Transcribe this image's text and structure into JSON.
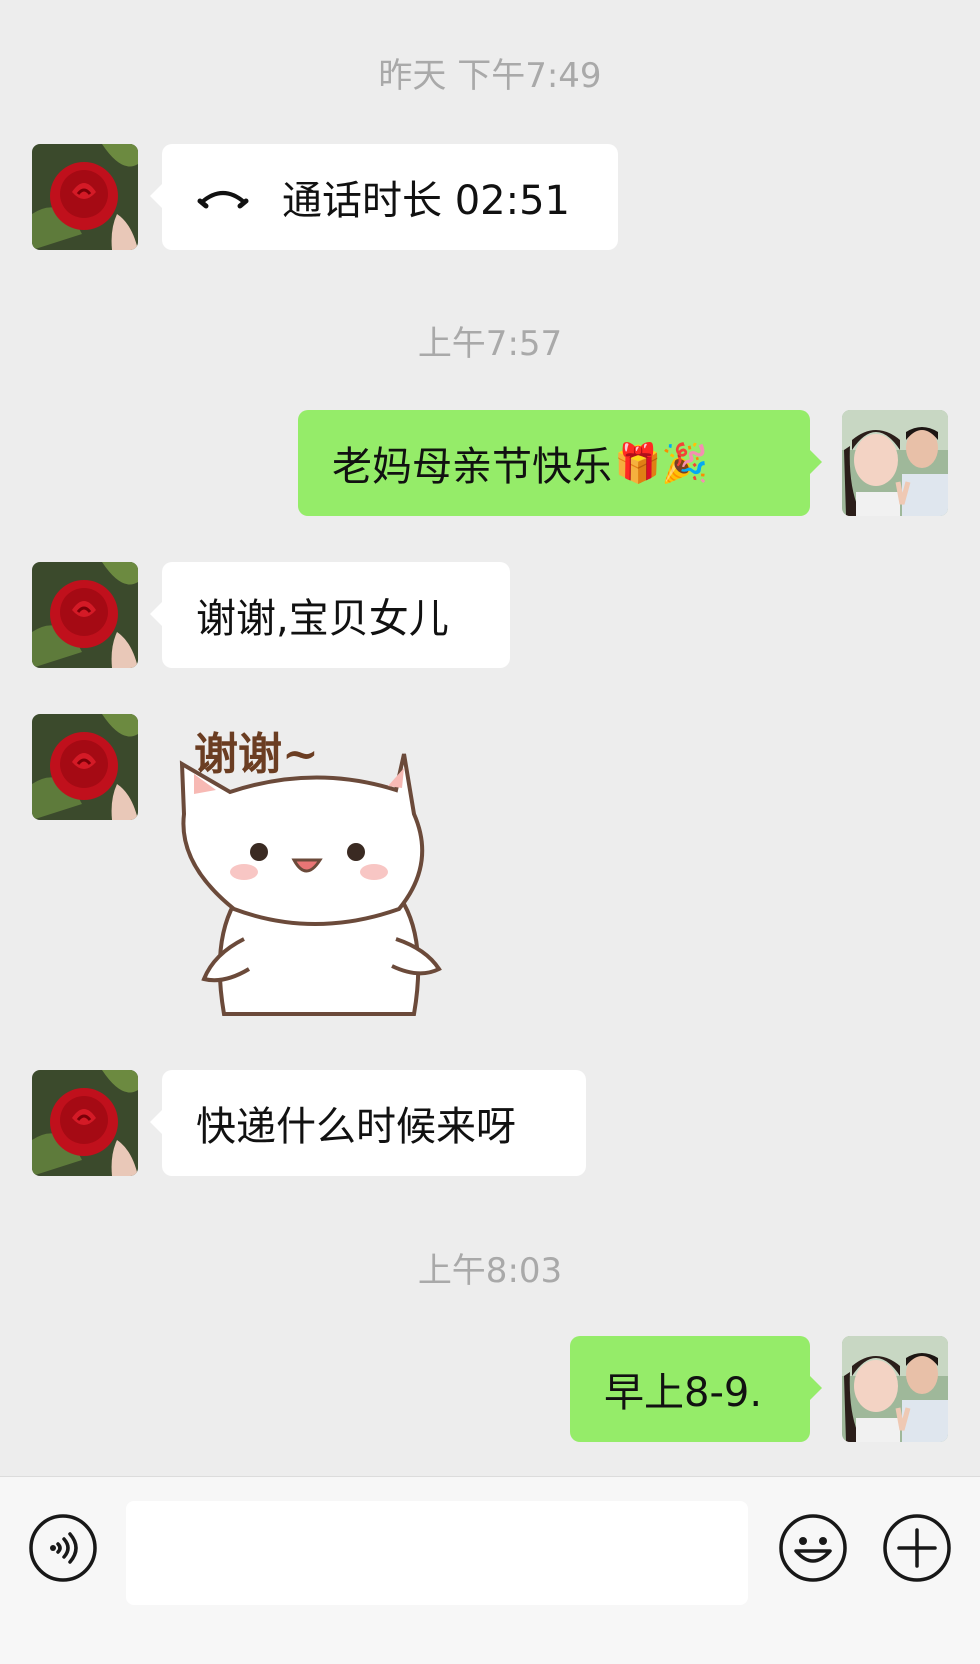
{
  "chat": {
    "timestamps": [
      "昨天 下午7:49",
      "上午7:57",
      "上午8:03"
    ],
    "call": {
      "icon": "phone-hangup-icon",
      "label": "通话时长 02:51"
    },
    "messages": {
      "sent_1": {
        "text": "老妈母亲节快乐",
        "emojis": "🎁🎉"
      },
      "recv_1": "谢谢,宝贝女儿",
      "sticker_text": "谢谢~",
      "recv_2": "快递什么时候来呀",
      "sent_2": "早上8-9."
    }
  },
  "input_bar": {
    "voice_icon": "voice-icon",
    "emoji_icon": "smiley-icon",
    "more_icon": "plus-icon",
    "input_value": ""
  },
  "colors": {
    "background": "#ededed",
    "incoming_bubble": "#ffffff",
    "outgoing_bubble": "#95ec69",
    "timestamp": "#a9a9a9"
  }
}
